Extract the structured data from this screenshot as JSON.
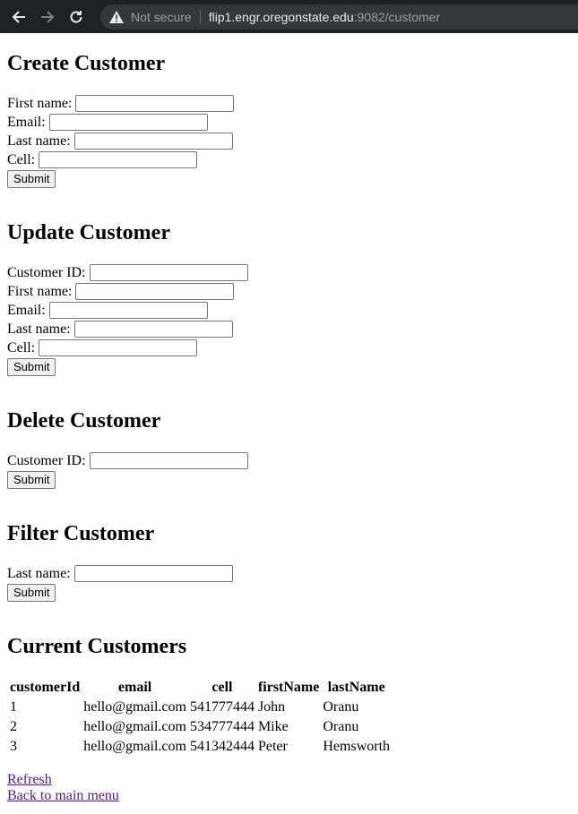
{
  "browser": {
    "not_secure": "Not secure",
    "url_host": "flip1.engr.oregonstate.edu",
    "url_rest": ":9082/customer"
  },
  "create": {
    "title": "Create Customer",
    "first_name_label": "First name:",
    "email_label": "Email:",
    "last_name_label": "Last name:",
    "cell_label": "Cell:",
    "submit": "Submit"
  },
  "update": {
    "title": "Update Customer",
    "customer_id_label": "Customer ID:",
    "first_name_label": "First name:",
    "email_label": "Email:",
    "last_name_label": "Last name:",
    "cell_label": "Cell:",
    "submit": "Submit"
  },
  "delete": {
    "title": "Delete Customer",
    "customer_id_label": "Customer ID:",
    "submit": "Submit"
  },
  "filter": {
    "title": "Filter Customer",
    "last_name_label": "Last name:",
    "submit": "Submit"
  },
  "current": {
    "title": "Current Customers",
    "columns": [
      "customerId",
      "email",
      "cell",
      "firstName",
      "lastName"
    ],
    "rows": [
      [
        "1",
        "hello@gmail.com",
        "541777444",
        "John",
        "Oranu"
      ],
      [
        "2",
        "hello@gmail.com",
        "534777444",
        "Mike",
        "Oranu"
      ],
      [
        "3",
        "hello@gmail.com",
        "541342444",
        "Peter",
        "Hemsworth"
      ]
    ]
  },
  "links": {
    "refresh": "Refresh",
    "back": "Back to main menu"
  }
}
